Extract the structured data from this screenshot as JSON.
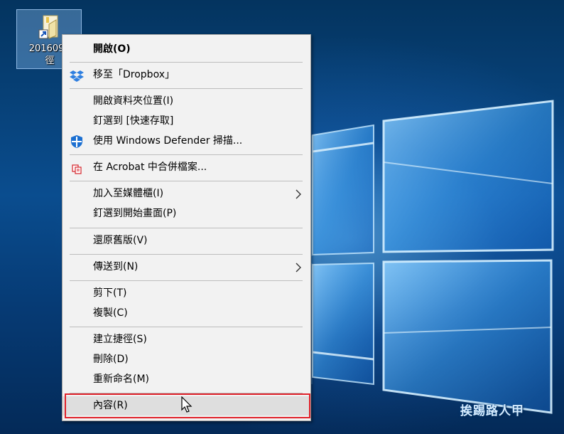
{
  "desktop": {
    "icon": {
      "name": "201609 -\n徑",
      "icon": "shortcut-folder-icon"
    },
    "watermark": "挨踢路人甲"
  },
  "context_menu": {
    "items": [
      {
        "label": "開啟(O)",
        "bold": true,
        "icon": null
      },
      {
        "label": "移至「Dropbox」",
        "icon": "dropbox-icon"
      },
      {
        "label": "開啟資料夾位置(I)",
        "icon": null
      },
      {
        "label": "釘選到 [快速存取]",
        "icon": null
      },
      {
        "label": "使用 Windows Defender 掃描...",
        "icon": "windows-defender-shield-icon"
      },
      {
        "label": "在 Acrobat 中合併檔案...",
        "icon": "acrobat-icon"
      },
      {
        "label": "加入至媒體櫃(I)",
        "icon": null,
        "submenu": true
      },
      {
        "label": "釘選到開始畫面(P)",
        "icon": null
      },
      {
        "label": "還原舊版(V)",
        "icon": null
      },
      {
        "label": "傳送到(N)",
        "icon": null,
        "submenu": true
      },
      {
        "label": "剪下(T)",
        "icon": null
      },
      {
        "label": "複製(C)",
        "icon": null
      },
      {
        "label": "建立捷徑(S)",
        "icon": null
      },
      {
        "label": "刪除(D)",
        "icon": null
      },
      {
        "label": "重新命名(M)",
        "icon": null
      },
      {
        "label": "內容(R)",
        "icon": null,
        "highlighted": true
      }
    ]
  },
  "colors": {
    "highlight_frame": "#e0222b",
    "menu_background": "#f2f2f2",
    "dropbox_blue": "#2f7fe0",
    "defender_blue": "#1b6fd1",
    "acrobat_red": "#d4232a"
  }
}
